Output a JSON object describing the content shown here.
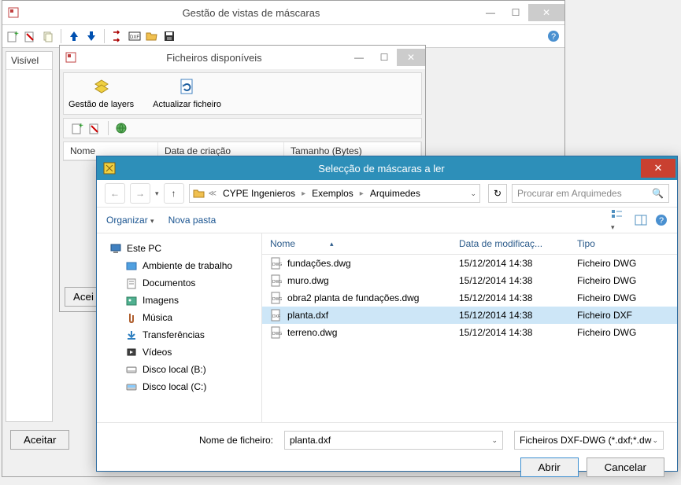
{
  "win1": {
    "title": "Gestão de vistas de máscaras",
    "left_header": "Visível",
    "accept": "Aceitar"
  },
  "win2": {
    "title": "Ficheiros disponíveis",
    "tool_layers": "Gestão de layers",
    "tool_refresh": "Actualizar ficheiro",
    "cols": {
      "nome": "Nome",
      "data": "Data de criação",
      "tam": "Tamanho (Bytes)"
    },
    "accept_partial": "Acei"
  },
  "filedlg": {
    "title": "Selecção de máscaras a ler",
    "breadcrumb": [
      "CYPE Ingenieros",
      "Exemplos",
      "Arquimedes"
    ],
    "search_placeholder": "Procurar em Arquimedes",
    "toolbar": {
      "organize": "Organizar",
      "newfolder": "Nova pasta"
    },
    "tree": {
      "root": "Este PC",
      "items": [
        "Ambiente de trabalho",
        "Documentos",
        "Imagens",
        "Música",
        "Transferências",
        "Vídeos",
        "Disco local (B:)",
        "Disco local (C:)"
      ]
    },
    "cols": {
      "name": "Nome",
      "date": "Data de modificaç...",
      "type": "Tipo"
    },
    "files": [
      {
        "name": "fundações.dwg",
        "date": "15/12/2014 14:38",
        "type": "Ficheiro DWG",
        "sel": false
      },
      {
        "name": "muro.dwg",
        "date": "15/12/2014 14:38",
        "type": "Ficheiro DWG",
        "sel": false
      },
      {
        "name": "obra2 planta de fundações.dwg",
        "date": "15/12/2014 14:38",
        "type": "Ficheiro DWG",
        "sel": false
      },
      {
        "name": "planta.dxf",
        "date": "15/12/2014 14:38",
        "type": "Ficheiro DXF",
        "sel": true
      },
      {
        "name": "terreno.dwg",
        "date": "15/12/2014 14:38",
        "type": "Ficheiro DWG",
        "sel": false
      }
    ],
    "filename_label": "Nome de ficheiro:",
    "filename_value": "planta.dxf",
    "filter": "Ficheiros DXF-DWG (*.dxf;*.dwg",
    "open": "Abrir",
    "cancel": "Cancelar"
  }
}
